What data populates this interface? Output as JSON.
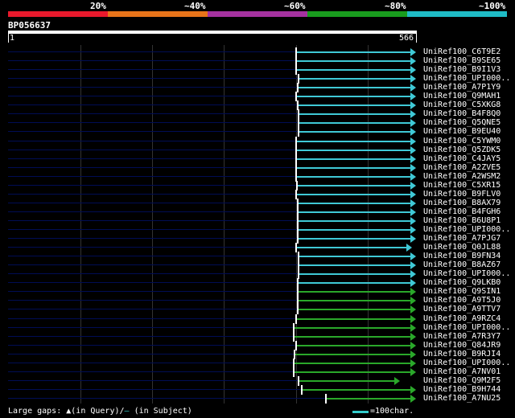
{
  "colors": {
    "band_20": "#e8192c",
    "band_40": "#e8741a",
    "band_60": "#a532a0",
    "band_80": "#199c1e",
    "band_100": "#1fbcc6",
    "row_bg": "#000d55",
    "hit_cyan": "#3fc9d6",
    "hit_green": "#2aa82a"
  },
  "percent_labels": [
    "20%",
    "~40%",
    "~60%",
    "~80%",
    "~100%"
  ],
  "query": {
    "title": "BP056637",
    "start": "1",
    "end": "566"
  },
  "rows": [
    {
      "label": "UniRef100_C6T9E2",
      "color": "cyan"
    },
    {
      "label": "UniRef100_B9SE65",
      "color": "cyan"
    },
    {
      "label": "UniRef100_B9I1V3",
      "color": "cyan"
    },
    {
      "label": "UniRef100_UPI000..",
      "color": "cyan"
    },
    {
      "label": "UniRef100_A7P1Y9",
      "color": "cyan"
    },
    {
      "label": "UniRef100_Q9MAH1",
      "color": "cyan"
    },
    {
      "label": "UniRef100_C5XKG8",
      "color": "cyan"
    },
    {
      "label": "UniRef100_B4F8Q0",
      "color": "cyan"
    },
    {
      "label": "UniRef100_Q5QNE5",
      "color": "cyan"
    },
    {
      "label": "UniRef100_B9EU40",
      "color": "cyan"
    },
    {
      "label": "UniRef100_C5YWM0",
      "color": "cyan"
    },
    {
      "label": "UniRef100_Q5ZDK5",
      "color": "cyan"
    },
    {
      "label": "UniRef100_C4JAY5",
      "color": "cyan"
    },
    {
      "label": "UniRef100_A2ZVE5",
      "color": "cyan"
    },
    {
      "label": "UniRef100_A2WSM2",
      "color": "cyan"
    },
    {
      "label": "UniRef100_C5XR15",
      "color": "cyan"
    },
    {
      "label": "UniRef100_B9FLV0",
      "color": "cyan"
    },
    {
      "label": "UniRef100_B8AX79",
      "color": "cyan"
    },
    {
      "label": "UniRef100_B4FGH6",
      "color": "cyan"
    },
    {
      "label": "UniRef100_B6U8P1",
      "color": "cyan"
    },
    {
      "label": "UniRef100_UPI000..",
      "color": "cyan"
    },
    {
      "label": "UniRef100_A7PJG7",
      "color": "cyan"
    },
    {
      "label": "UniRef100_Q0JL88",
      "color": "cyan"
    },
    {
      "label": "UniRef100_B9FN34",
      "color": "cyan"
    },
    {
      "label": "UniRef100_B8AZ67",
      "color": "cyan"
    },
    {
      "label": "UniRef100_UPI000..",
      "color": "cyan"
    },
    {
      "label": "UniRef100_Q9LKB0",
      "color": "cyan"
    },
    {
      "label": "UniRef100_Q9SIN1",
      "color": "green"
    },
    {
      "label": "UniRef100_A9T5J0",
      "color": "green"
    },
    {
      "label": "UniRef100_A9TTV7",
      "color": "green"
    },
    {
      "label": "UniRef100_A9RZC4",
      "color": "green"
    },
    {
      "label": "UniRef100_UPI000..",
      "color": "green"
    },
    {
      "label": "UniRef100_A7R3Y7",
      "color": "green"
    },
    {
      "label": "UniRef100_Q84JR9",
      "color": "green"
    },
    {
      "label": "UniRef100_B9RJI4",
      "color": "green"
    },
    {
      "label": "UniRef100_UPI000..",
      "color": "green"
    },
    {
      "label": "UniRef100_A7NV01",
      "color": "green"
    },
    {
      "label": "UniRef100_Q9M2F5",
      "color": "green"
    },
    {
      "label": "UniRef100_B9H744",
      "color": "green"
    },
    {
      "label": "UniRef100_A7NU25",
      "color": "green"
    }
  ],
  "footer": {
    "gaps_prefix": "Large gaps: ",
    "query_marker": "▲",
    "query_text": "(in Query)/",
    "subject_marker": "–",
    "subject_text": " (in Subject)",
    "scale_label": "=100char."
  }
}
